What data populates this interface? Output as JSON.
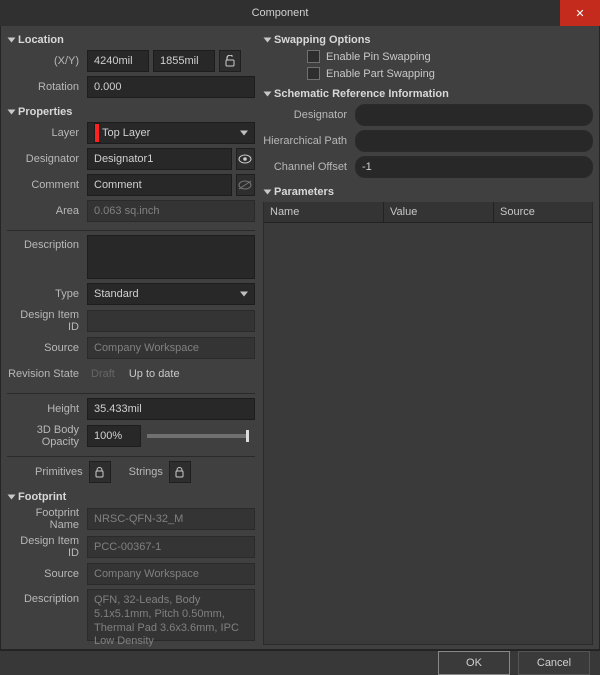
{
  "window": {
    "title": "Component"
  },
  "location": {
    "header": "Location",
    "xy_label": "(X/Y)",
    "x": "4240mil",
    "y": "1855mil",
    "rotation_label": "Rotation",
    "rotation": "0.000"
  },
  "properties": {
    "header": "Properties",
    "layer_label": "Layer",
    "layer": "Top Layer",
    "designator_label": "Designator",
    "designator": "Designator1",
    "comment_label": "Comment",
    "comment": "Comment",
    "area_label": "Area",
    "area": "0.063 sq.inch",
    "description_label": "Description",
    "description": "",
    "type_label": "Type",
    "type": "Standard",
    "design_item_id_label": "Design Item ID",
    "design_item_id": "",
    "source_label": "Source",
    "source": "Company Workspace",
    "revision_state_label": "Revision State",
    "revision_draft": "Draft",
    "revision_state": "Up to date",
    "height_label": "Height",
    "height": "35.433mil",
    "opacity_label": "3D Body Opacity",
    "opacity": "100%",
    "primitives_label": "Primitives",
    "strings_label": "Strings"
  },
  "footprint": {
    "header": "Footprint",
    "name_label": "Footprint Name",
    "name": "NRSC-QFN-32_M",
    "design_item_id_label": "Design Item ID",
    "design_item_id": "PCC-00367-1",
    "source_label": "Source",
    "source": "Company Workspace",
    "description_label": "Description",
    "description": "QFN, 32-Leads, Body 5.1x5.1mm, Pitch 0.50mm, Thermal Pad 3.6x3.6mm, IPC Low Density"
  },
  "swapping": {
    "header": "Swapping Options",
    "pin": "Enable Pin Swapping",
    "part": "Enable Part Swapping"
  },
  "schref": {
    "header": "Schematic Reference Information",
    "designator_label": "Designator",
    "designator": "",
    "path_label": "Hierarchical Path",
    "path": "",
    "offset_label": "Channel Offset",
    "offset": "-1"
  },
  "parameters": {
    "header": "Parameters",
    "col_name": "Name",
    "col_value": "Value",
    "col_source": "Source"
  },
  "footer": {
    "ok": "OK",
    "cancel": "Cancel"
  }
}
